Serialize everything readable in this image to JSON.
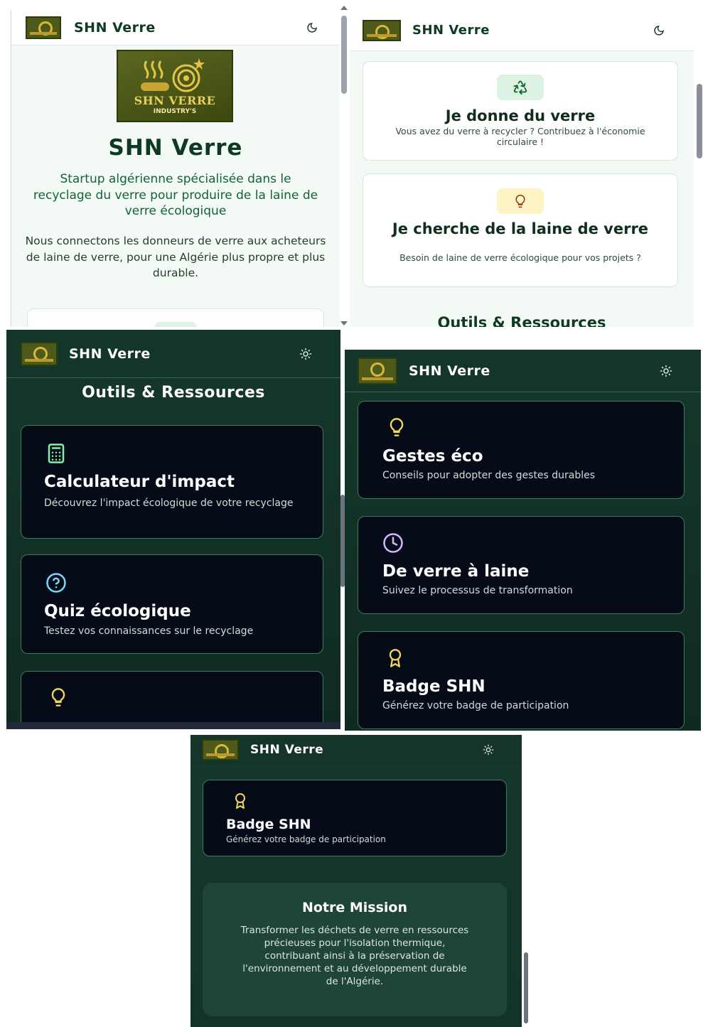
{
  "app": {
    "brand": "SHN Verre",
    "logo_text_line1": "SHN VERRE",
    "logo_text_line2": "INDUSTRY'S"
  },
  "hero": {
    "title": "SHN Verre",
    "tagline": "Startup algérienne spécialisée dans le recyclage du verre pour produire de la laine de verre écologique",
    "description": "Nous connectons les donneurs de verre aux acheteurs de laine de verre, pour une Algérie plus propre et plus durable."
  },
  "actions": [
    {
      "title": "Je donne du verre",
      "desc": "Vous avez du verre à recycler ? Contribuez à l'économie circulaire !",
      "icon": "recycle-icon"
    },
    {
      "title": "Je cherche de la laine de verre",
      "desc": "Besoin de laine de verre écologique pour vos projets ?",
      "icon": "lightbulb-icon"
    }
  ],
  "tools": {
    "section_title": "Outils & Ressources",
    "items": [
      {
        "title": "Calculateur d'impact",
        "desc": "Découvrez l'impact écologique de votre recyclage",
        "icon": "calculator-icon"
      },
      {
        "title": "Quiz écologique",
        "desc": "Testez vos connaissances sur le recyclage",
        "icon": "help-circle-icon"
      },
      {
        "title": "Gestes éco",
        "desc": "Conseils pour adopter des gestes durables",
        "icon": "lightbulb-icon"
      },
      {
        "title": "De verre à laine",
        "desc": "Suivez le processus de transformation",
        "icon": "clock-icon"
      },
      {
        "title": "Badge SHN",
        "desc": "Générez votre badge de participation",
        "icon": "award-icon"
      }
    ]
  },
  "mission": {
    "title": "Notre Mission",
    "text": "Transformer les déchets de verre en ressources précieuses pour l'isolation thermique, contribuant ainsi à la préservation de l'environnement et au développement durable de l'Algérie."
  },
  "colors": {
    "light_bg": "#f3faf5",
    "dark_bg": "#15392b",
    "card_dark": "#060b18",
    "accent_green": "#0e3a22",
    "icon_yellow": "#f3d65a",
    "icon_purple": "#d8b4fe",
    "icon_cyan": "#7dd3fc",
    "icon_lime": "#86efac"
  }
}
